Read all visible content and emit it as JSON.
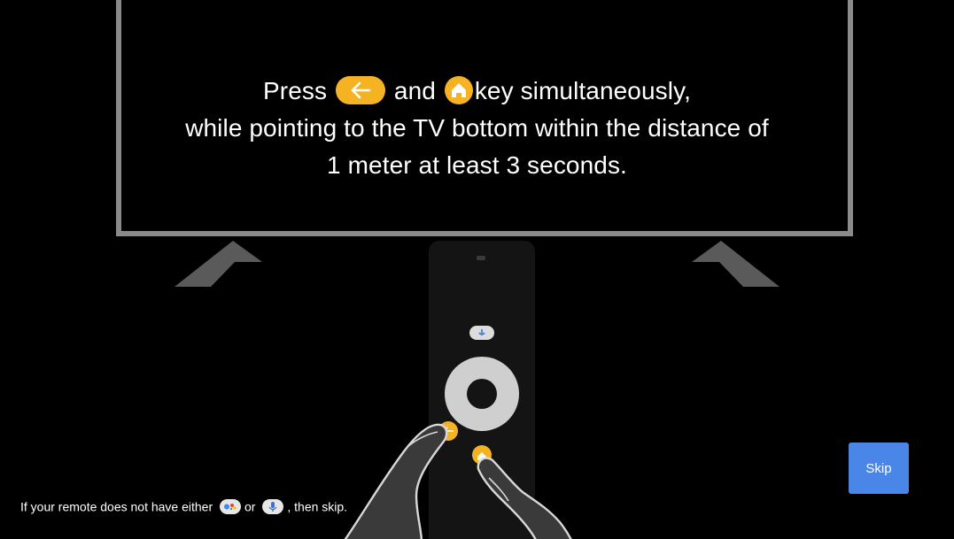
{
  "instruction": {
    "press": "Press",
    "and": "and",
    "key_simultaneously": "key simultaneously,",
    "line2": "while pointing to the TV bottom within the distance of",
    "line3": "1 meter at least 3 seconds."
  },
  "note": {
    "prefix": "If your remote does not have either",
    "or": "or",
    "suffix": ", then skip."
  },
  "skip_label": "Skip",
  "colors": {
    "key_accent": "#f5b323",
    "skip_button": "#4a86e8",
    "tv_frame": "#8a8a8a"
  },
  "icons": {
    "back_key": "back-arrow-icon",
    "home_key": "home-icon",
    "assistant": "assistant-icon",
    "mic": "microphone-icon"
  }
}
